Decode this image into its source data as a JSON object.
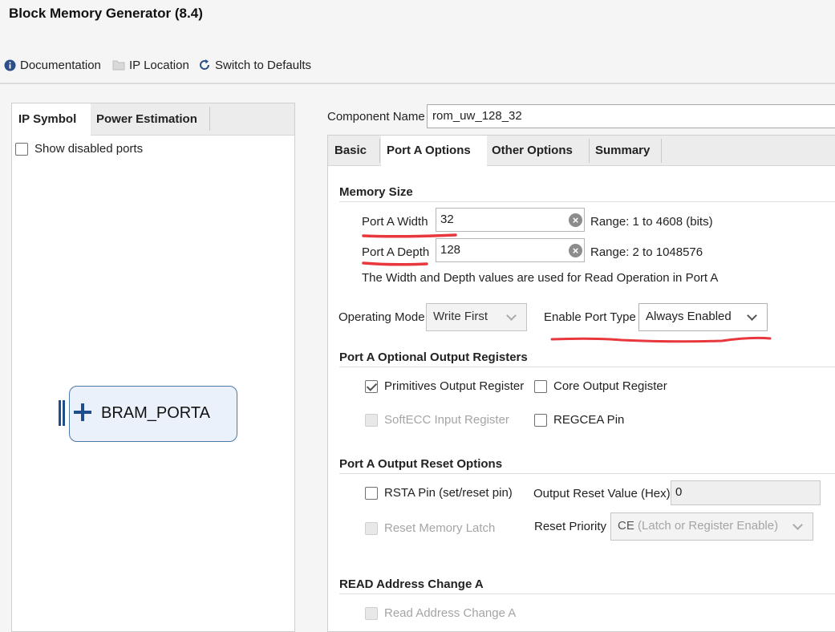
{
  "window": {
    "title": "Block Memory Generator (8.4)"
  },
  "toolbar": {
    "documentation": "Documentation",
    "ip_location": "IP Location",
    "switch_defaults": "Switch to Defaults"
  },
  "left": {
    "tabs": [
      "IP Symbol",
      "Power Estimation"
    ],
    "show_disabled_label": "Show disabled ports",
    "block_label": "BRAM_PORTA"
  },
  "component": {
    "label": "Component Name",
    "value": "rom_uw_128_32"
  },
  "tabs": [
    "Basic",
    "Port A Options",
    "Other Options",
    "Summary"
  ],
  "memory_size": {
    "heading": "Memory Size",
    "width_label": "Port A Width",
    "width_value": "32",
    "width_range": "Range: 1 to 4608 (bits)",
    "depth_label": "Port A Depth",
    "depth_value": "128",
    "depth_range": "Range: 2 to 1048576",
    "note": "The Width and Depth values are used for Read Operation in Port A"
  },
  "operating": {
    "mode_label": "Operating Mode",
    "mode_value": "Write First",
    "enable_label": "Enable Port Type",
    "enable_value": "Always Enabled"
  },
  "optional_regs": {
    "heading": "Port A Optional Output Registers",
    "primitives": "Primitives Output Register",
    "core": "Core Output Register",
    "softecc": "SoftECC Input Register",
    "regcea": "REGCEA Pin"
  },
  "reset": {
    "heading": "Port A Output Reset Options",
    "rsta": "RSTA Pin (set/reset pin)",
    "value_label": "Output Reset Value (Hex)",
    "value": "0",
    "reset_latch": "Reset Memory Latch",
    "priority_label": "Reset Priority",
    "priority_value_prefix": "CE",
    "priority_value_rest": " (Latch or Register Enable)"
  },
  "read_addr": {
    "heading": "READ Address Change A",
    "checkbox": "Read Address Change A"
  },
  "colors": {
    "annotation_red": "#e8383d",
    "block_border": "#4d78a8"
  }
}
